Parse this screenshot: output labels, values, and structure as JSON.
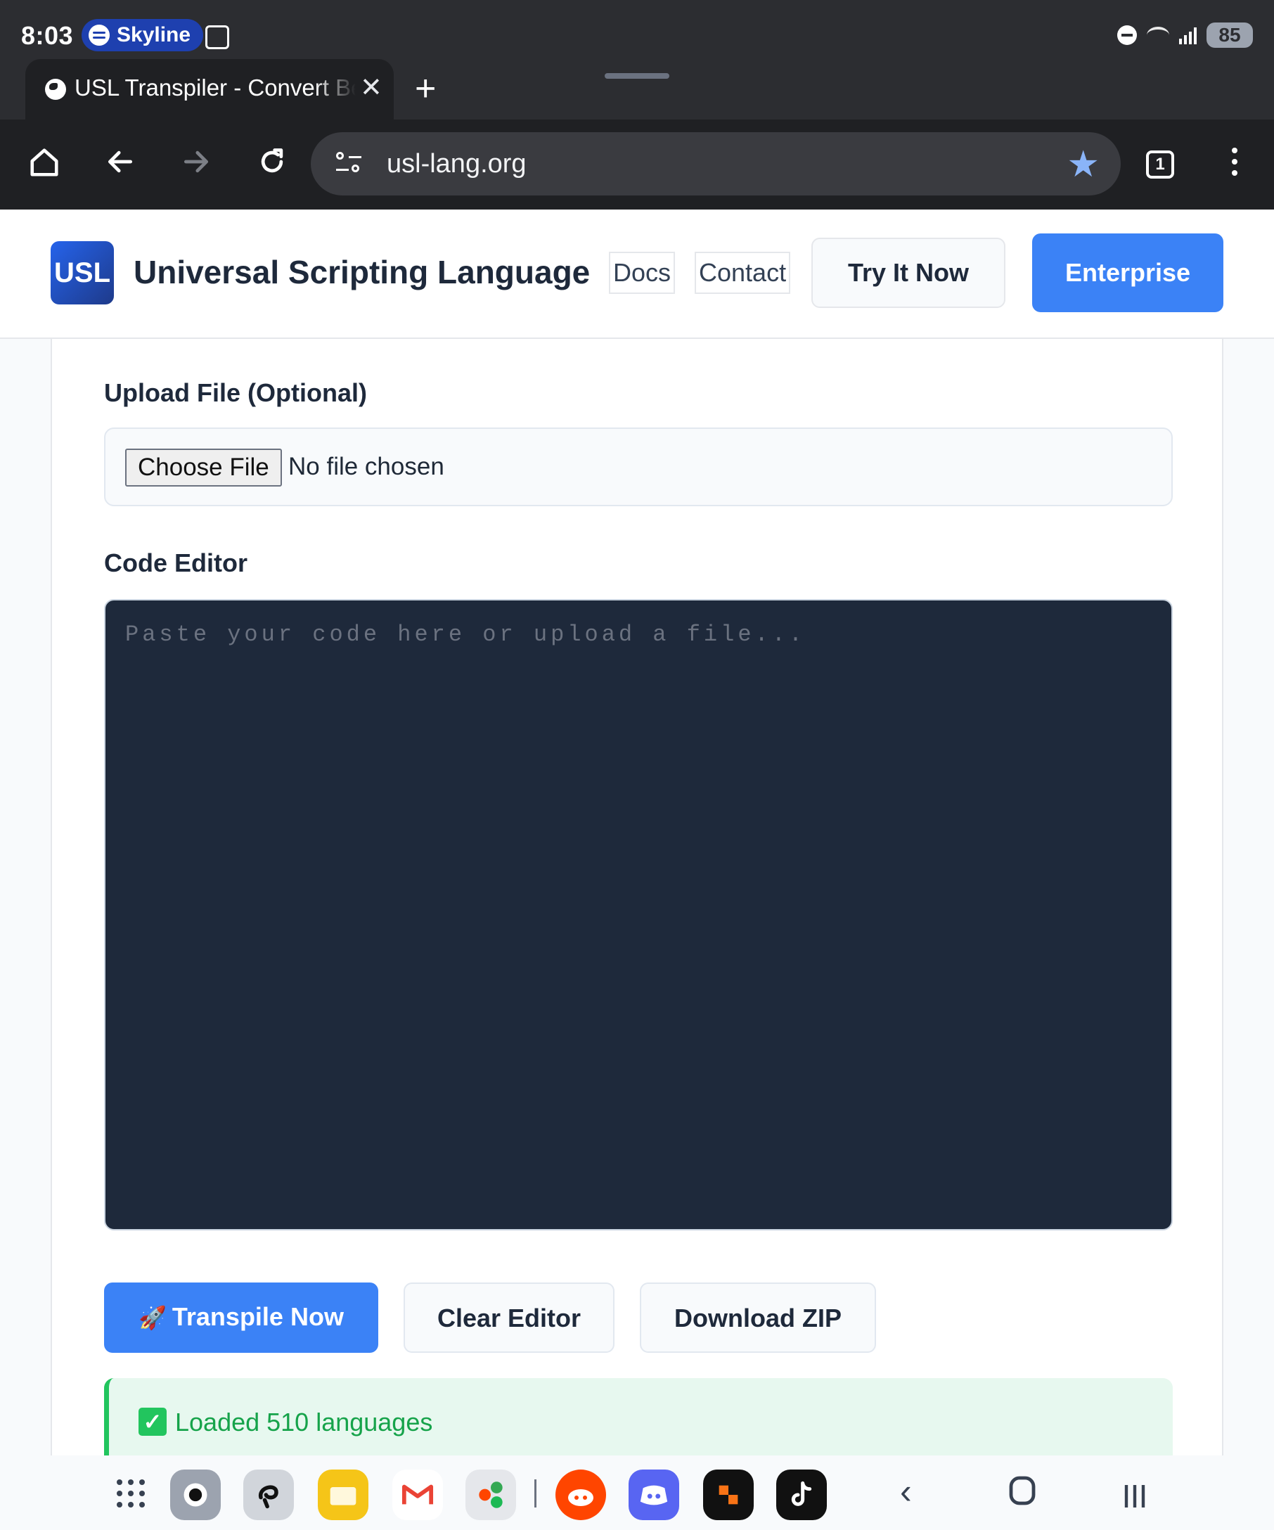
{
  "status_bar": {
    "time": "8:03",
    "media_pill": "Skyline",
    "battery": "85",
    "icons": [
      "spotify-icon",
      "screenshot-icon",
      "dnd-icon",
      "wifi-icon",
      "signal-icon",
      "battery-icon"
    ]
  },
  "browser": {
    "tab_title": "USL Transpiler - Convert Be",
    "url": "usl-lang.org",
    "tab_count": "1",
    "icons": [
      "home-icon",
      "back-icon",
      "forward-icon",
      "reload-icon",
      "site-info-icon",
      "bookmark-star-icon",
      "tabs-icon",
      "more-icon"
    ]
  },
  "header": {
    "logo_text": "USL",
    "brand": "Universal Scripting Language",
    "nav": [
      "Docs",
      "Contact"
    ],
    "try_label": "Try It Now",
    "enterprise_label": "Enterprise"
  },
  "form": {
    "upload_label": "Upload File (Optional)",
    "choose_file": "Choose File",
    "no_file": "No file chosen",
    "editor_label": "Code Editor",
    "editor_placeholder": "Paste your code here or upload a file..."
  },
  "actions": {
    "transpile": "Transpile Now",
    "clear": "Clear Editor",
    "download": "Download ZIP"
  },
  "status": {
    "message": "Loaded 510 languages"
  },
  "colors": {
    "accent": "#3b82f6",
    "editor_bg": "#1e293b",
    "success": "#16a34a"
  }
}
